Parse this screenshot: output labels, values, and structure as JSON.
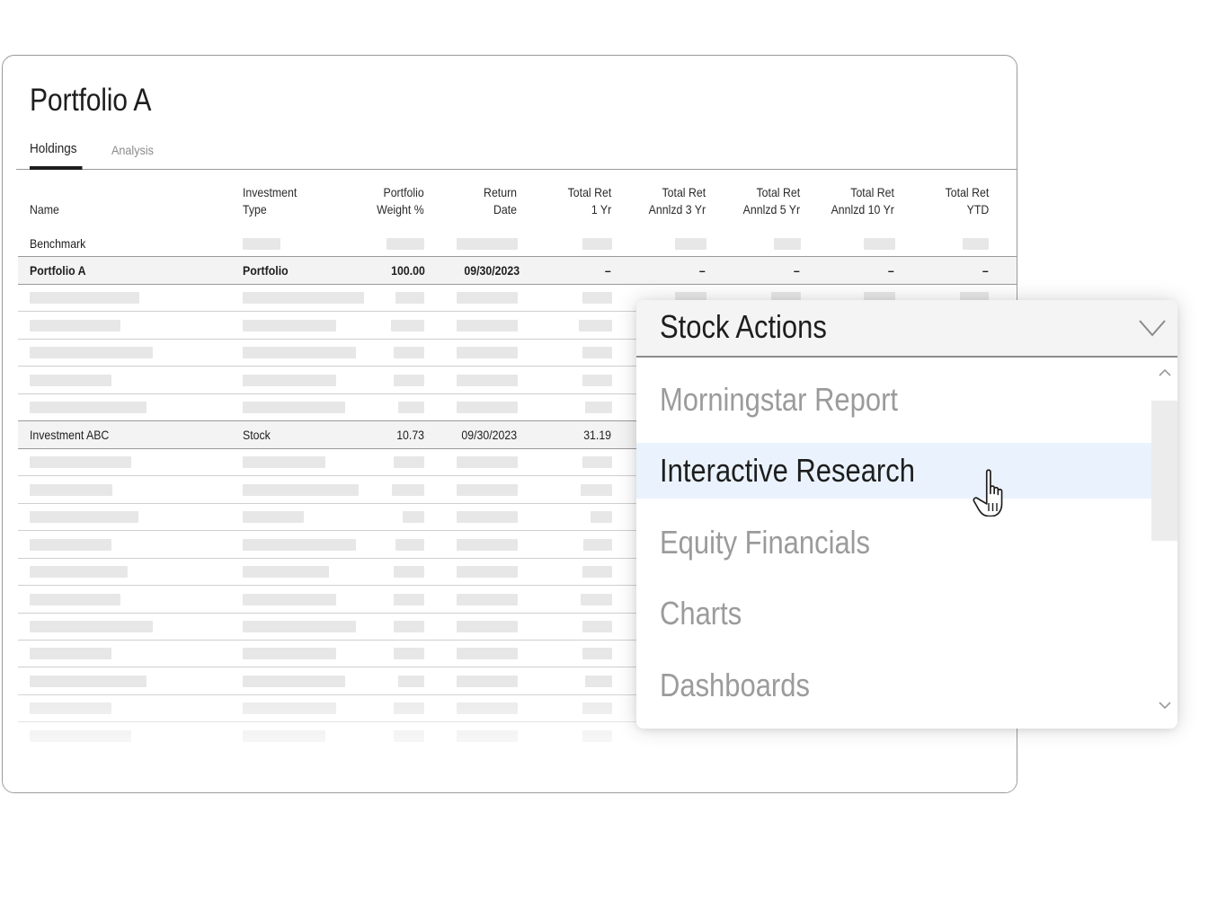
{
  "portfolio": {
    "title": "Portfolio A",
    "tabs": [
      {
        "label": "Holdings",
        "active": true
      },
      {
        "label": "Analysis",
        "active": false
      }
    ]
  },
  "table": {
    "headers": {
      "name": "Name",
      "type": [
        "Investment",
        "Type"
      ],
      "weight": [
        "Portfolio",
        "Weight %"
      ],
      "date": [
        "Return",
        "Date"
      ],
      "ret1": [
        "Total Ret",
        "1 Yr"
      ],
      "ret3": [
        "Total Ret",
        "Annlzd 3 Yr"
      ],
      "ret5": [
        "Total Ret",
        "Annlzd 5 Yr"
      ],
      "ret10": [
        "Total Ret",
        "Annlzd 10 Yr"
      ],
      "ytd": [
        "Total Ret",
        "YTD"
      ]
    },
    "benchmark": "Benchmark",
    "portfolio_row": {
      "name": "Portfolio A",
      "type": "Portfolio",
      "weight": "100.00",
      "date": "09/30/2023",
      "ret1": "–",
      "ret3": "–",
      "ret5": "–",
      "ret10": "–",
      "ytd": "–"
    },
    "investment_row": {
      "name": "Investment ABC",
      "type": "Stock",
      "weight": "10.73",
      "date": "09/30/2023",
      "ret1": "31.19"
    }
  },
  "stock_actions": {
    "title": "Stock Actions",
    "items": [
      {
        "label": "Morningstar Report",
        "selected": false
      },
      {
        "label": "Interactive Research",
        "selected": true
      },
      {
        "label": "Equity Financials",
        "selected": false
      },
      {
        "label": "Charts",
        "selected": false
      },
      {
        "label": "Dashboards",
        "selected": false
      }
    ]
  },
  "colors": {
    "selected_item_bg": "#eaf3fd",
    "placeholder_bar": "#e7e7e7",
    "border": "#9a9a9a"
  }
}
